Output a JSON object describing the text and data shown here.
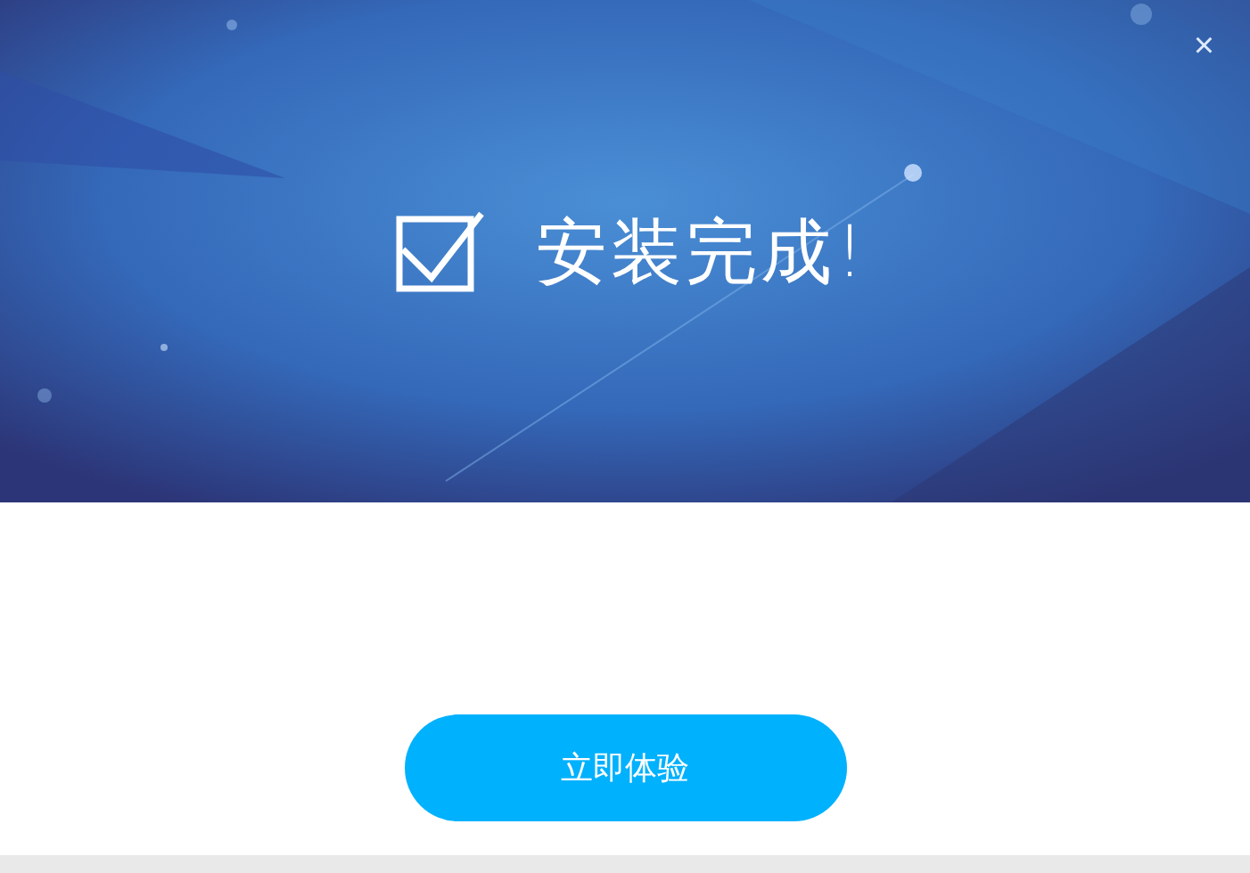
{
  "dialog": {
    "close": "×",
    "banner": {
      "title": "安装完成!",
      "checked": true
    },
    "button": "立即体验"
  }
}
